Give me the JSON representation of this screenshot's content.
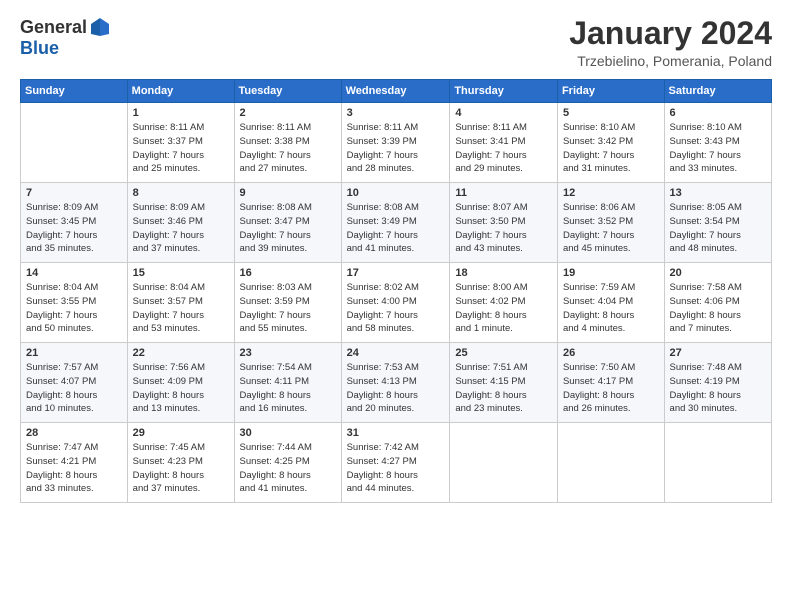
{
  "logo": {
    "general": "General",
    "blue": "Blue"
  },
  "title": "January 2024",
  "location": "Trzebielino, Pomerania, Poland",
  "days_header": [
    "Sunday",
    "Monday",
    "Tuesday",
    "Wednesday",
    "Thursday",
    "Friday",
    "Saturday"
  ],
  "weeks": [
    [
      {
        "num": "",
        "info": ""
      },
      {
        "num": "1",
        "info": "Sunrise: 8:11 AM\nSunset: 3:37 PM\nDaylight: 7 hours\nand 25 minutes."
      },
      {
        "num": "2",
        "info": "Sunrise: 8:11 AM\nSunset: 3:38 PM\nDaylight: 7 hours\nand 27 minutes."
      },
      {
        "num": "3",
        "info": "Sunrise: 8:11 AM\nSunset: 3:39 PM\nDaylight: 7 hours\nand 28 minutes."
      },
      {
        "num": "4",
        "info": "Sunrise: 8:11 AM\nSunset: 3:41 PM\nDaylight: 7 hours\nand 29 minutes."
      },
      {
        "num": "5",
        "info": "Sunrise: 8:10 AM\nSunset: 3:42 PM\nDaylight: 7 hours\nand 31 minutes."
      },
      {
        "num": "6",
        "info": "Sunrise: 8:10 AM\nSunset: 3:43 PM\nDaylight: 7 hours\nand 33 minutes."
      }
    ],
    [
      {
        "num": "7",
        "info": "Sunrise: 8:09 AM\nSunset: 3:45 PM\nDaylight: 7 hours\nand 35 minutes."
      },
      {
        "num": "8",
        "info": "Sunrise: 8:09 AM\nSunset: 3:46 PM\nDaylight: 7 hours\nand 37 minutes."
      },
      {
        "num": "9",
        "info": "Sunrise: 8:08 AM\nSunset: 3:47 PM\nDaylight: 7 hours\nand 39 minutes."
      },
      {
        "num": "10",
        "info": "Sunrise: 8:08 AM\nSunset: 3:49 PM\nDaylight: 7 hours\nand 41 minutes."
      },
      {
        "num": "11",
        "info": "Sunrise: 8:07 AM\nSunset: 3:50 PM\nDaylight: 7 hours\nand 43 minutes."
      },
      {
        "num": "12",
        "info": "Sunrise: 8:06 AM\nSunset: 3:52 PM\nDaylight: 7 hours\nand 45 minutes."
      },
      {
        "num": "13",
        "info": "Sunrise: 8:05 AM\nSunset: 3:54 PM\nDaylight: 7 hours\nand 48 minutes."
      }
    ],
    [
      {
        "num": "14",
        "info": "Sunrise: 8:04 AM\nSunset: 3:55 PM\nDaylight: 7 hours\nand 50 minutes."
      },
      {
        "num": "15",
        "info": "Sunrise: 8:04 AM\nSunset: 3:57 PM\nDaylight: 7 hours\nand 53 minutes."
      },
      {
        "num": "16",
        "info": "Sunrise: 8:03 AM\nSunset: 3:59 PM\nDaylight: 7 hours\nand 55 minutes."
      },
      {
        "num": "17",
        "info": "Sunrise: 8:02 AM\nSunset: 4:00 PM\nDaylight: 7 hours\nand 58 minutes."
      },
      {
        "num": "18",
        "info": "Sunrise: 8:00 AM\nSunset: 4:02 PM\nDaylight: 8 hours\nand 1 minute."
      },
      {
        "num": "19",
        "info": "Sunrise: 7:59 AM\nSunset: 4:04 PM\nDaylight: 8 hours\nand 4 minutes."
      },
      {
        "num": "20",
        "info": "Sunrise: 7:58 AM\nSunset: 4:06 PM\nDaylight: 8 hours\nand 7 minutes."
      }
    ],
    [
      {
        "num": "21",
        "info": "Sunrise: 7:57 AM\nSunset: 4:07 PM\nDaylight: 8 hours\nand 10 minutes."
      },
      {
        "num": "22",
        "info": "Sunrise: 7:56 AM\nSunset: 4:09 PM\nDaylight: 8 hours\nand 13 minutes."
      },
      {
        "num": "23",
        "info": "Sunrise: 7:54 AM\nSunset: 4:11 PM\nDaylight: 8 hours\nand 16 minutes."
      },
      {
        "num": "24",
        "info": "Sunrise: 7:53 AM\nSunset: 4:13 PM\nDaylight: 8 hours\nand 20 minutes."
      },
      {
        "num": "25",
        "info": "Sunrise: 7:51 AM\nSunset: 4:15 PM\nDaylight: 8 hours\nand 23 minutes."
      },
      {
        "num": "26",
        "info": "Sunrise: 7:50 AM\nSunset: 4:17 PM\nDaylight: 8 hours\nand 26 minutes."
      },
      {
        "num": "27",
        "info": "Sunrise: 7:48 AM\nSunset: 4:19 PM\nDaylight: 8 hours\nand 30 minutes."
      }
    ],
    [
      {
        "num": "28",
        "info": "Sunrise: 7:47 AM\nSunset: 4:21 PM\nDaylight: 8 hours\nand 33 minutes."
      },
      {
        "num": "29",
        "info": "Sunrise: 7:45 AM\nSunset: 4:23 PM\nDaylight: 8 hours\nand 37 minutes."
      },
      {
        "num": "30",
        "info": "Sunrise: 7:44 AM\nSunset: 4:25 PM\nDaylight: 8 hours\nand 41 minutes."
      },
      {
        "num": "31",
        "info": "Sunrise: 7:42 AM\nSunset: 4:27 PM\nDaylight: 8 hours\nand 44 minutes."
      },
      {
        "num": "",
        "info": ""
      },
      {
        "num": "",
        "info": ""
      },
      {
        "num": "",
        "info": ""
      }
    ]
  ]
}
